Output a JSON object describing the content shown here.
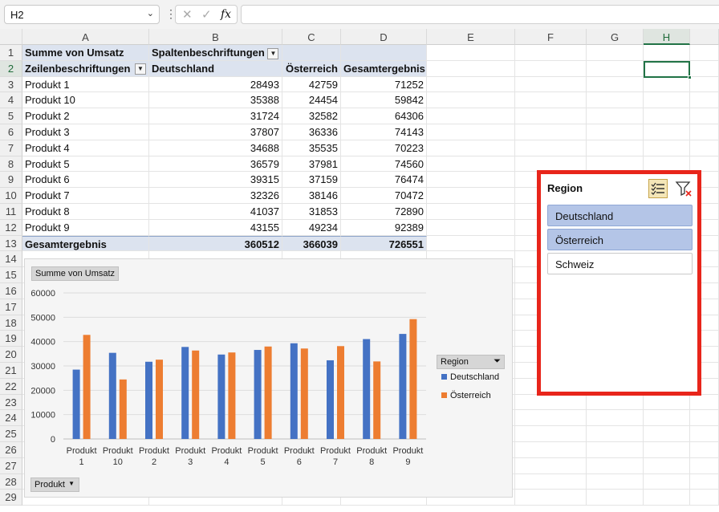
{
  "name_box": "H2",
  "formula_bar": {
    "fx_label": "fx",
    "value": ""
  },
  "columns": [
    "A",
    "B",
    "C",
    "D",
    "E",
    "F",
    "G",
    "H"
  ],
  "selected_column": "H",
  "selected_row": "2",
  "rows": [
    "1",
    "2",
    "3",
    "4",
    "5",
    "6",
    "7",
    "8",
    "9",
    "10",
    "11",
    "12",
    "13",
    "14",
    "15",
    "16",
    "17",
    "18",
    "19",
    "20",
    "21",
    "22",
    "23",
    "24",
    "25",
    "26",
    "27",
    "28",
    "29"
  ],
  "pivot": {
    "values_label": "Summe von Umsatz",
    "col_labels_header": "Spaltenbeschriftungen",
    "row_labels_header": "Zeilenbeschriftungen",
    "col_headers": [
      "Deutschland",
      "Österreich",
      "Gesamtergebnis"
    ],
    "rows": [
      {
        "label": "Produkt 1",
        "de": "28493",
        "at": "42759",
        "total": "71252"
      },
      {
        "label": "Produkt 10",
        "de": "35388",
        "at": "24454",
        "total": "59842"
      },
      {
        "label": "Produkt 2",
        "de": "31724",
        "at": "32582",
        "total": "64306"
      },
      {
        "label": "Produkt 3",
        "de": "37807",
        "at": "36336",
        "total": "74143"
      },
      {
        "label": "Produkt 4",
        "de": "34688",
        "at": "35535",
        "total": "70223"
      },
      {
        "label": "Produkt 5",
        "de": "36579",
        "at": "37981",
        "total": "74560"
      },
      {
        "label": "Produkt 6",
        "de": "39315",
        "at": "37159",
        "total": "76474"
      },
      {
        "label": "Produkt 7",
        "de": "32326",
        "at": "38146",
        "total": "70472"
      },
      {
        "label": "Produkt 8",
        "de": "41037",
        "at": "31853",
        "total": "72890"
      },
      {
        "label": "Produkt 9",
        "de": "43155",
        "at": "49234",
        "total": "92389"
      }
    ],
    "grand_total": {
      "label": "Gesamtergebnis",
      "de": "360512",
      "at": "366039",
      "total": "726551"
    }
  },
  "chart_data": {
    "type": "bar",
    "title": "",
    "value_field_button": "Summe von Umsatz",
    "axis_field_button": "Produkt",
    "legend_field_button": "Region",
    "legend_position": "right",
    "categories": [
      [
        "Produkt",
        "1"
      ],
      [
        "Produkt",
        "10"
      ],
      [
        "Produkt",
        "2"
      ],
      [
        "Produkt",
        "3"
      ],
      [
        "Produkt",
        "4"
      ],
      [
        "Produkt",
        "5"
      ],
      [
        "Produkt",
        "6"
      ],
      [
        "Produkt",
        "7"
      ],
      [
        "Produkt",
        "8"
      ],
      [
        "Produkt",
        "9"
      ]
    ],
    "series": [
      {
        "name": "Deutschland",
        "color": "#4472c4",
        "values": [
          28493,
          35388,
          31724,
          37807,
          34688,
          36579,
          39315,
          32326,
          41037,
          43155
        ]
      },
      {
        "name": "Österreich",
        "color": "#ed7d31",
        "values": [
          42759,
          24454,
          32582,
          36336,
          35535,
          37981,
          37159,
          38146,
          31853,
          49234
        ]
      }
    ],
    "ylim": [
      0,
      60000
    ],
    "yticks": [
      "0",
      "10000",
      "20000",
      "30000",
      "40000",
      "50000",
      "60000"
    ],
    "grid": true
  },
  "slicer": {
    "title": "Region",
    "items": [
      {
        "label": "Deutschland",
        "selected": true
      },
      {
        "label": "Österreich",
        "selected": true
      },
      {
        "label": "Schweiz",
        "selected": false
      }
    ]
  }
}
